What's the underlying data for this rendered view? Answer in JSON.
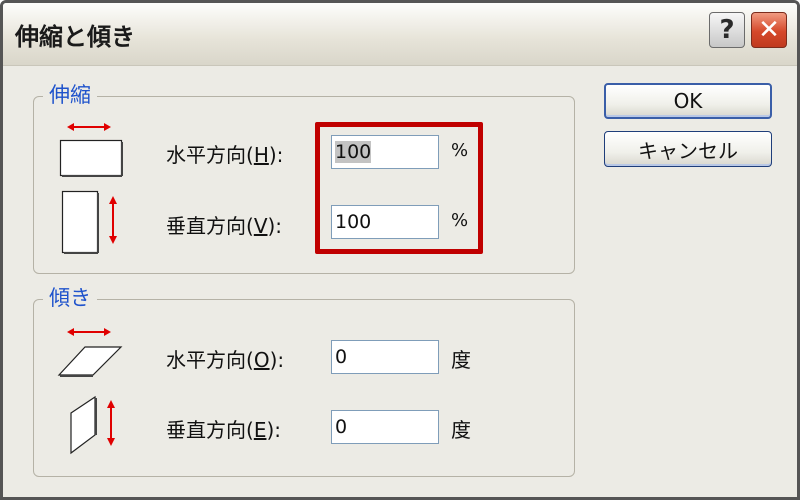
{
  "window": {
    "title": "伸縮と傾き",
    "help_label": "?",
    "close_label": "✕"
  },
  "scale": {
    "group_title": "伸縮",
    "horizontal": {
      "label_prefix": "水平方向(",
      "mnemonic": "H",
      "label_suffix": "):",
      "value": "100",
      "unit": "%"
    },
    "vertical": {
      "label_prefix": "垂直方向(",
      "mnemonic": "V",
      "label_suffix": "):",
      "value": "100",
      "unit": "%"
    }
  },
  "skew": {
    "group_title": "傾き",
    "horizontal": {
      "label_prefix": "水平方向(",
      "mnemonic": "O",
      "label_suffix": "):",
      "value": "0",
      "unit": "度"
    },
    "vertical": {
      "label_prefix": "垂直方向(",
      "mnemonic": "E",
      "label_suffix": "):",
      "value": "0",
      "unit": "度"
    }
  },
  "buttons": {
    "ok": "OK",
    "cancel": "キャンセル"
  },
  "colors": {
    "group_title": "#1f53cc",
    "highlight": "#c00000",
    "arrow": "#e00000"
  }
}
